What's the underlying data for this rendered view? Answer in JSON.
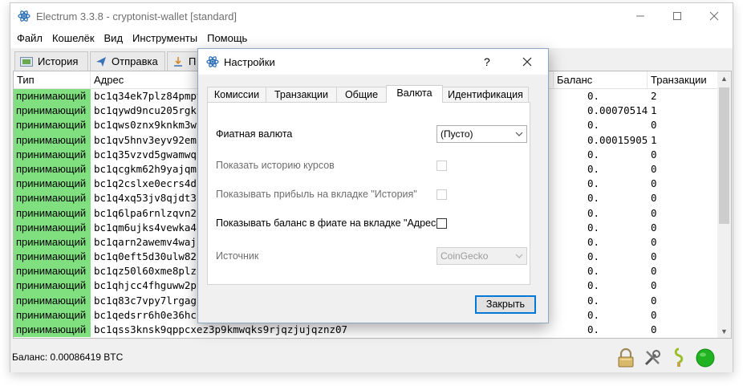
{
  "window": {
    "title": "Electrum 3.3.8  -  cryptonist-wallet  [standard]",
    "controls": [
      "minimize",
      "maximize",
      "close"
    ]
  },
  "menu": [
    "Файл",
    "Кошелёк",
    "Вид",
    "Инструменты",
    "Помощь"
  ],
  "main_tabs": [
    {
      "label": "История",
      "icon": "history-icon"
    },
    {
      "label": "Отправка",
      "icon": "send-icon"
    },
    {
      "label": "П",
      "icon": "receive-icon"
    }
  ],
  "table": {
    "headers": {
      "type": "Тип",
      "address": "Адрес",
      "balance": "Баланс",
      "tx": "Транзакции"
    },
    "rows": [
      {
        "type": "принимающий",
        "address": "bc1q34ek7plz84pmpy",
        "balance": "0.",
        "tx": "2"
      },
      {
        "type": "принимающий",
        "address": "bc1qywd9ncu205rgk",
        "balance": "0.00070514",
        "tx": "1"
      },
      {
        "type": "принимающий",
        "address": "bc1qws0znx9knkm3w",
        "balance": "0.",
        "tx": "0"
      },
      {
        "type": "принимающий",
        "address": "bc1qv5hnv3eyv92em",
        "balance": "0.00015905",
        "tx": "1"
      },
      {
        "type": "принимающий",
        "address": "bc1q35vzvd5gwamwq",
        "balance": "0.",
        "tx": "0"
      },
      {
        "type": "принимающий",
        "address": "bc1qcgkm62h9yajqm",
        "balance": "0.",
        "tx": "0"
      },
      {
        "type": "принимающий",
        "address": "bc1q2cslxe0ecrs4d",
        "balance": "0.",
        "tx": "0"
      },
      {
        "type": "принимающий",
        "address": "bc1q4xq53jv8qjdt3",
        "balance": "0.",
        "tx": "0"
      },
      {
        "type": "принимающий",
        "address": "bc1q6lpa6rnlzqvn2",
        "balance": "0.",
        "tx": "0"
      },
      {
        "type": "принимающий",
        "address": "bc1qm6ujks4vewka4",
        "balance": "0.",
        "tx": "0"
      },
      {
        "type": "принимающий",
        "address": "bc1qarn2awemv4waj",
        "balance": "0.",
        "tx": "0"
      },
      {
        "type": "принимающий",
        "address": "bc1q0eft5d30ulw82",
        "balance": "0.",
        "tx": "0"
      },
      {
        "type": "принимающий",
        "address": "bc1qz50l60xme8plz",
        "balance": "0.",
        "tx": "0"
      },
      {
        "type": "принимающий",
        "address": "bc1qhjcc4fhguww2p",
        "balance": "0.",
        "tx": "0"
      },
      {
        "type": "принимающий",
        "address": "bc1q83c7vpy7lrgag",
        "balance": "0.",
        "tx": "0"
      },
      {
        "type": "принимающий",
        "address": "bc1qedsrr6h0e36hc",
        "balance": "0.",
        "tx": "0"
      },
      {
        "type": "принимающий",
        "address": "bc1qss3knsk9qppcxez3p9kmwqks9rjqzjujqznz07",
        "balance": "0.",
        "tx": "0"
      }
    ]
  },
  "status": {
    "balance_text": "Баланс: 0.00086419 BTC",
    "icons": [
      "lock-icon",
      "tools-icon",
      "seed-icon",
      "network-status-icon"
    ],
    "network_color": "#22b322"
  },
  "dialog": {
    "title": "Настройки",
    "help": "?",
    "tabs": [
      "Комиссии",
      "Транзакции",
      "Общие",
      "Валюта",
      "Идентификация"
    ],
    "active_tab": "Валюта",
    "fields": {
      "fiat_label": "Фиатная валюта",
      "fiat_value": "(Пусто)",
      "history_rates_label": "Показать историю курсов",
      "history_profit_label": "Показывать прибыль на вкладке \"История\"",
      "address_fiat_label": "Показывать баланс в фиате на вкладке \"Адреса\"",
      "source_label": "Источник",
      "source_value": "CoinGecko"
    },
    "close_button": "Закрыть"
  },
  "colors": {
    "receiving_bg": "#80e080",
    "accent": "#0078d7",
    "electrum_blue": "#2f71b7"
  }
}
